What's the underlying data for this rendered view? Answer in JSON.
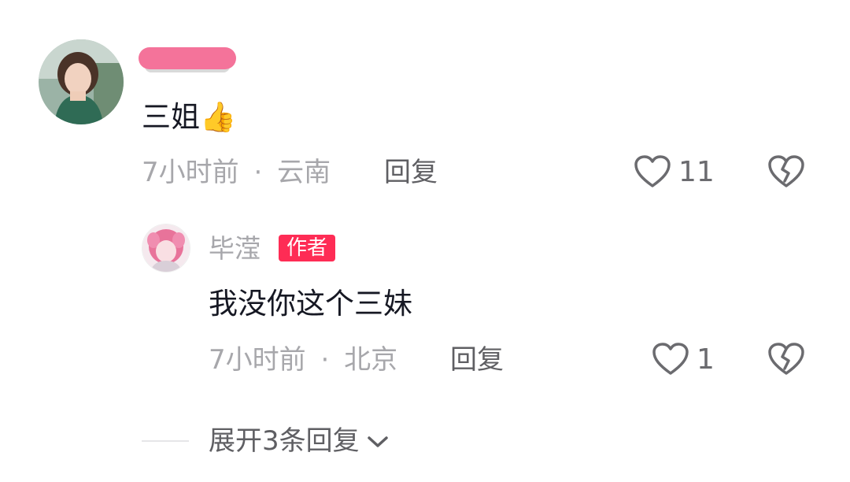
{
  "comment": {
    "text": "三姐👍",
    "time": "7小时前",
    "separator": "·",
    "location": "云南",
    "reply_label": "回复",
    "like_count": "11",
    "icons": {
      "like": "heart-outline-icon",
      "dislike": "broken-heart-icon"
    }
  },
  "reply": {
    "username": "毕滢",
    "badge": "作者",
    "text": "我没你这个三妹",
    "time": "7小时前",
    "separator": "·",
    "location": "北京",
    "reply_label": "回复",
    "like_count": "1",
    "icons": {
      "like": "heart-outline-icon",
      "dislike": "broken-heart-icon"
    }
  },
  "expand": {
    "label": "展开3条回复",
    "icon": "chevron-down-icon"
  },
  "colors": {
    "badge": "#fe2c55",
    "redaction": "#f4739a",
    "meta_text": "#a7a7ab",
    "main_text": "#161823"
  }
}
